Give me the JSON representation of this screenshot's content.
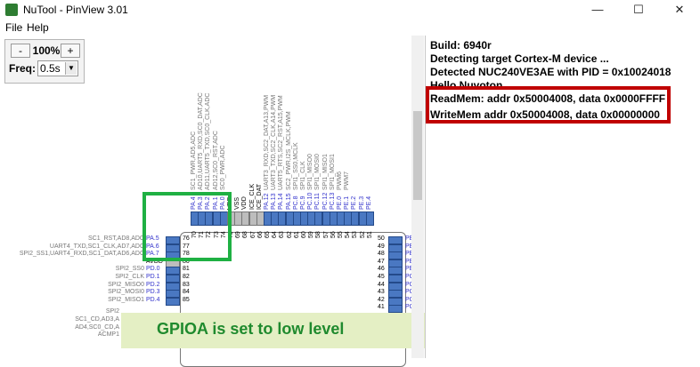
{
  "window": {
    "title": "NuTool - PinView 3.01",
    "minimize": "—",
    "maximize": "☐",
    "close": "✕"
  },
  "menu": {
    "file": "File",
    "help": "Help"
  },
  "controls": {
    "zoom_minus": "-",
    "zoom_value": "100%",
    "zoom_plus": "+",
    "freq_label": "Freq:",
    "freq_value": "0.5s",
    "dropdown_arrow": "▼"
  },
  "top_pins": [
    {
      "func": "SC1_PWR,AD5,ADC",
      "pin": "PA.4",
      "num": "70",
      "type": "io"
    },
    {
      "func": "AD10,UART5_RXD,SC0_DAT,ADC",
      "pin": "PA.3",
      "num": "71",
      "type": "io"
    },
    {
      "func": "AD11,UART5_TXD,SC0_CLK,ADC",
      "pin": "PA.2",
      "num": "72",
      "type": "io"
    },
    {
      "func": "AD12,SC0_RST,ADC",
      "pin": "PA.1",
      "num": "73",
      "type": "io"
    },
    {
      "func": "SC0_PWR,ADC",
      "pin": "PA.0",
      "num": "74",
      "type": "io"
    },
    {
      "func": "",
      "pin": "VDD",
      "num": "75",
      "type": "power"
    },
    {
      "func": "",
      "pin": "VSS",
      "num": "69",
      "type": "power"
    },
    {
      "func": "",
      "pin": "VDD",
      "num": "68",
      "type": "power"
    },
    {
      "func": "",
      "pin": "ICE_CLK",
      "num": "67",
      "type": "power"
    },
    {
      "func": "",
      "pin": "ICE_DAT",
      "num": "66",
      "type": "power"
    },
    {
      "func": "UART3_RXD,SC2_DAT,A13,PWM",
      "pin": "PA.12",
      "num": "65",
      "type": "io"
    },
    {
      "func": "UART3_TXD,SC2_CLK,A14,PWM",
      "pin": "PA.13",
      "num": "64",
      "type": "io"
    },
    {
      "func": "UART5_RTS,SC2_RST,A15,PWM",
      "pin": "PA.14",
      "num": "63",
      "type": "io"
    },
    {
      "func": "SC2_PWR,I2S_MCLK,PWM",
      "pin": "PA.15",
      "num": "62",
      "type": "io"
    },
    {
      "func": "SPI1_SS0,MCLK",
      "pin": "PC.8",
      "num": "61",
      "type": "io"
    },
    {
      "func": "SPI1_CLK",
      "pin": "PC.9",
      "num": "60",
      "type": "io"
    },
    {
      "func": "SPI1_MISO0",
      "pin": "PC.10",
      "num": "59",
      "type": "io"
    },
    {
      "func": "SPI1_MOSI0",
      "pin": "PC.11",
      "num": "58",
      "type": "io"
    },
    {
      "func": "SPI1_MISO1",
      "pin": "PC.12",
      "num": "57",
      "type": "io"
    },
    {
      "func": "SPI1_MOSI1",
      "pin": "PC.13",
      "num": "56",
      "type": "io"
    },
    {
      "func": "PWM6",
      "pin": "PE.0",
      "num": "55",
      "type": "io"
    },
    {
      "func": "PWM7",
      "pin": "PE.1",
      "num": "54",
      "type": "io"
    },
    {
      "func": "",
      "pin": "PE.2",
      "num": "53",
      "type": "io"
    },
    {
      "func": "",
      "pin": "PE.3",
      "num": "52",
      "type": "io"
    },
    {
      "func": "",
      "pin": "PE.4",
      "num": "51",
      "type": "io"
    }
  ],
  "left_pins": [
    {
      "func": "SC1_RST,AD8,ADC",
      "pin": "PA.5",
      "num": "76",
      "type": "io"
    },
    {
      "func": "UART4_TXD,SC1_CLK,AD7,ADC",
      "pin": "PA.6",
      "num": "77",
      "type": "io"
    },
    {
      "func": "SPI2_SS1,UART4_RXD,SC1_DAT,AD6,ADC",
      "pin": "PA.7",
      "num": "78",
      "type": "io"
    },
    {
      "func": "",
      "pin": "AVDD",
      "num": "80",
      "type": "power"
    },
    {
      "func": "SPI2_SS0",
      "pin": "PD.0",
      "num": "81",
      "type": "io"
    },
    {
      "func": "SPI2_CLK",
      "pin": "PD.1",
      "num": "82",
      "type": "io"
    },
    {
      "func": "SPI2_MISO0",
      "pin": "PD.2",
      "num": "83",
      "type": "io"
    },
    {
      "func": "SPI2_MOSI0",
      "pin": "PD.3",
      "num": "84",
      "type": "io"
    },
    {
      "func": "SPI2_MISO1",
      "pin": "PD.4",
      "num": "85",
      "type": "io"
    },
    {
      "func": "SPI2",
      "pin": "",
      "num": "",
      "type": "io"
    },
    {
      "func": "SC1_CD,AD3,A",
      "pin": "",
      "num": "",
      "type": "io"
    },
    {
      "func": "AD4,SC0_CD,A",
      "pin": "",
      "num": "",
      "type": "io"
    },
    {
      "func": "ACMP1",
      "pin": "",
      "num": "",
      "type": "io"
    }
  ],
  "right_pins": [
    {
      "num": "50",
      "pin": "PE"
    },
    {
      "num": "49",
      "pin": "PE"
    },
    {
      "num": "48",
      "pin": "PE"
    },
    {
      "num": "47",
      "pin": "PE"
    },
    {
      "num": "46",
      "pin": "PE"
    },
    {
      "num": "45",
      "pin": "PC"
    },
    {
      "num": "44",
      "pin": "PC"
    },
    {
      "num": "43",
      "pin": "PC"
    },
    {
      "num": "42",
      "pin": "PC"
    },
    {
      "num": "41",
      "pin": "PC"
    }
  ],
  "log": [
    "Build: 6940r",
    "Detecting target Cortex-M device ...",
    "Detected NUC240VE3AE with PID = 0x10024018",
    "Hello Nuvoton",
    "ReadMem: addr 0x50004008, data 0x0000FFFF",
    "WriteMem addr 0x50004008, data 0x00000000"
  ],
  "callout": "GPIOA is set to low level",
  "colors": {
    "pin_io": "#4a78c2",
    "pin_power": "#bdbdbd",
    "pin_label": "#3333cc",
    "green_box": "#1fb043",
    "red_box": "#c00000",
    "callout_bg": "#e4efc4",
    "callout_text": "#1f8a2e"
  }
}
